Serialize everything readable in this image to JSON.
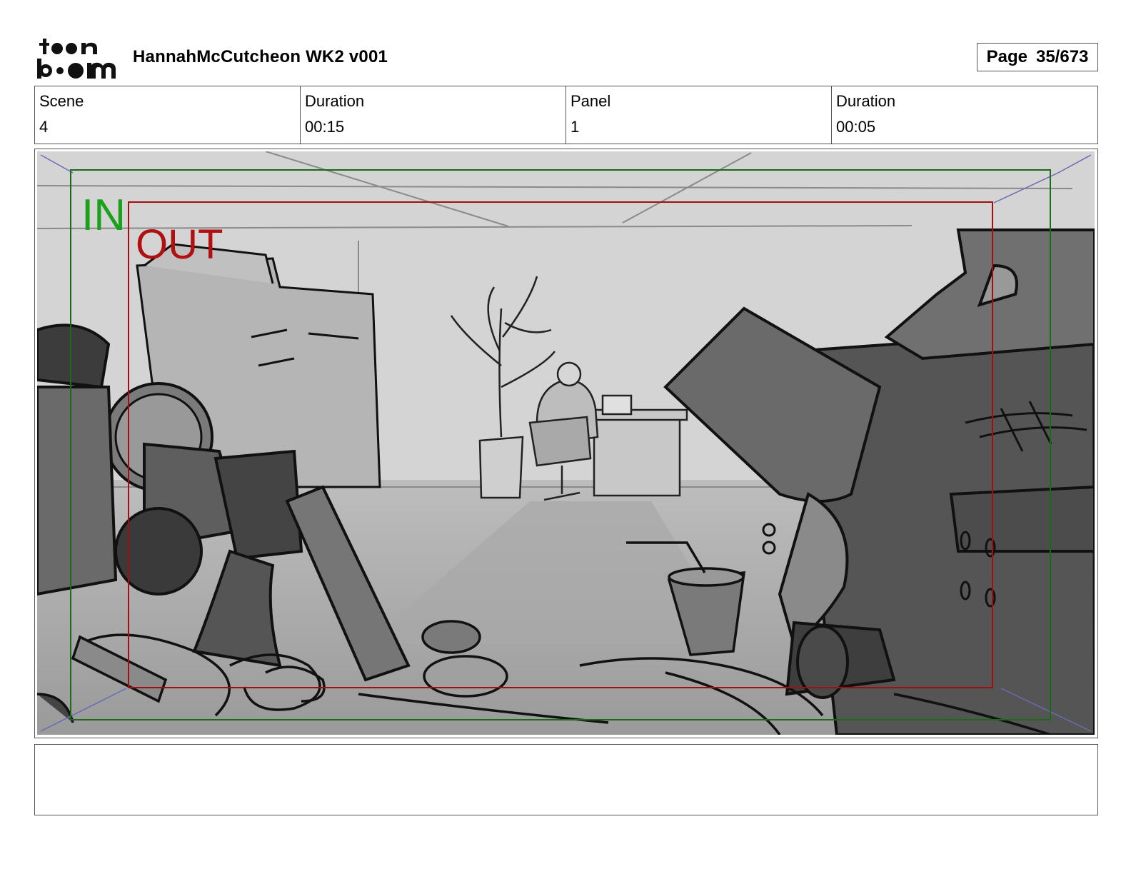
{
  "header": {
    "logo_text": "toon boom",
    "title": "HannahMcCutcheon WK2 v001",
    "page_label": "Page",
    "page_value": "35/673"
  },
  "info": {
    "scene_label": "Scene",
    "scene_value": "4",
    "scene_duration_label": "Duration",
    "scene_duration_value": "00:15",
    "panel_label": "Panel",
    "panel_value": "1",
    "panel_duration_label": "Duration",
    "panel_duration_value": "00:05"
  },
  "panel": {
    "in_label": "IN",
    "out_label": "OUT",
    "in_color": "#1a8a1a",
    "out_color": "#b01010"
  },
  "notes": {
    "text": ""
  }
}
